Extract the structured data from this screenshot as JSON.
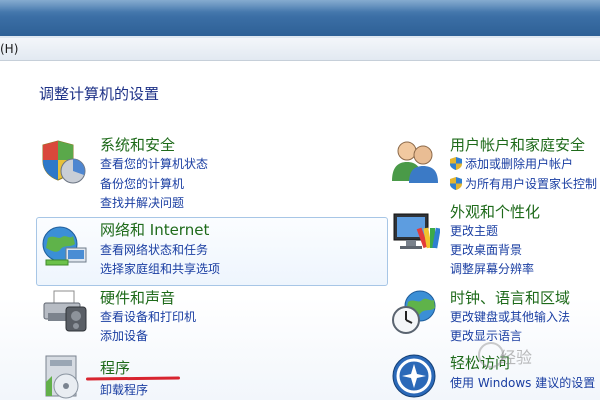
{
  "menubar": {
    "help_label": "(H)"
  },
  "main": {
    "title": "调整计算机的设置"
  },
  "categories": {
    "security": {
      "title": "系统和安全",
      "links": [
        "查看您的计算机状态",
        "备份您的计算机",
        "查找并解决问题"
      ]
    },
    "network": {
      "title": "网络和 Internet",
      "links": [
        "查看网络状态和任务",
        "选择家庭组和共享选项"
      ]
    },
    "hardware": {
      "title": "硬件和声音",
      "links": [
        "查看设备和打印机",
        "添加设备"
      ]
    },
    "programs": {
      "title": "程序",
      "links": [
        "卸载程序"
      ]
    },
    "user_accounts": {
      "title": "用户帐户和家庭安全",
      "links": [
        "添加或删除用户帐户",
        "为所有用户设置家长控制"
      ]
    },
    "appearance": {
      "title": "外观和个性化",
      "links": [
        "更改主题",
        "更改桌面背景",
        "调整屏幕分辨率"
      ]
    },
    "clock": {
      "title": "时钟、语言和区域",
      "links": [
        "更改键盘或其他输入法",
        "更改显示语言"
      ]
    },
    "ease": {
      "title": "轻松访问",
      "links": [
        "使用 Windows 建议的设置"
      ]
    }
  },
  "watermark": {
    "text": "经验"
  },
  "colors": {
    "category_title": "#1e6a1a",
    "link": "#1a3ea2",
    "page_title": "#1e3287",
    "highlight_border": "#a7c6e6",
    "annotation_underline": "#d8242f"
  },
  "icons": {
    "security": "shield-pie-icon",
    "network": "globe-network-icon",
    "hardware": "printer-icon",
    "programs": "program-disc-icon",
    "user_accounts": "users-icon",
    "appearance": "monitor-palette-icon",
    "clock": "clock-globe-icon",
    "ease": "ease-of-access-icon",
    "uac": "uac-shield-icon"
  }
}
